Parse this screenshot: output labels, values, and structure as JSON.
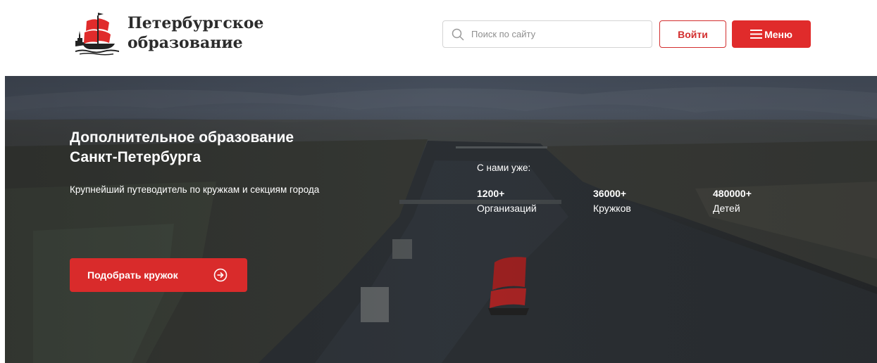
{
  "header": {
    "logo": {
      "line1": "Петербургское",
      "line2": "образование"
    },
    "search": {
      "placeholder": "Поиск по сайту"
    },
    "login_label": "Войти",
    "menu_label": "Меню"
  },
  "hero": {
    "title_line1": "Дополнительное образование",
    "title_line2": "Санкт-Петербурга",
    "subtitle": "Крупнейший путеводитель по кружкам и секциям города",
    "cta_label": "Подобрать кружок",
    "stats_label": "С нами уже:",
    "stats": [
      {
        "value": "1200+",
        "label": "Организаций"
      },
      {
        "value": "36000+",
        "label": "Кружков"
      },
      {
        "value": "480000+",
        "label": "Детей"
      }
    ]
  },
  "colors": {
    "brand_red": "#e02b2b",
    "text_dark": "#2b2b2b",
    "border_gray": "#d4d4d4"
  }
}
